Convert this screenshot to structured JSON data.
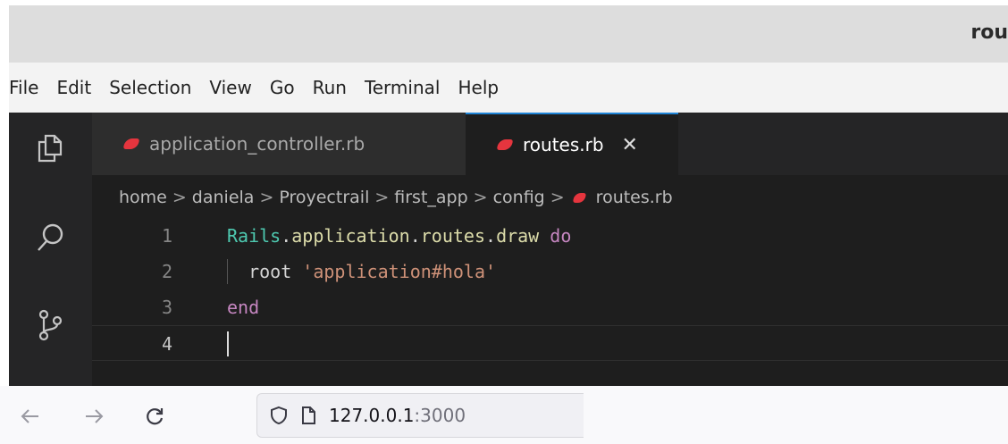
{
  "window": {
    "title": "rou"
  },
  "menu": [
    "File",
    "Edit",
    "Selection",
    "View",
    "Go",
    "Run",
    "Terminal",
    "Help"
  ],
  "activity_icons": [
    "files-icon",
    "search-icon",
    "source-control-icon"
  ],
  "tabs": [
    {
      "label": "application_controller.rb",
      "active": false
    },
    {
      "label": "routes.rb",
      "active": true,
      "close": "✕"
    }
  ],
  "breadcrumb": [
    "home",
    "daniela",
    "Proyectrail",
    "first_app",
    "config",
    "routes.rb"
  ],
  "code_lines": [
    {
      "num": "1",
      "tokens": [
        {
          "t": "Rails",
          "k": "const"
        },
        {
          "t": ".",
          "k": "plain"
        },
        {
          "t": "application",
          "k": "meth"
        },
        {
          "t": ".",
          "k": "plain"
        },
        {
          "t": "routes",
          "k": "meth"
        },
        {
          "t": ".",
          "k": "plain"
        },
        {
          "t": "draw",
          "k": "meth"
        },
        {
          "t": " ",
          "k": "plain"
        },
        {
          "t": "do",
          "k": "kw"
        }
      ]
    },
    {
      "num": "2",
      "tokens": [
        {
          "t": "  root ",
          "k": "plain"
        },
        {
          "t": "'application#hola'",
          "k": "str"
        }
      ]
    },
    {
      "num": "3",
      "tokens": [
        {
          "t": "end",
          "k": "kw"
        }
      ]
    },
    {
      "num": "4",
      "tokens": []
    }
  ],
  "browser": {
    "back_icon": "back-arrow-icon",
    "forward_icon": "forward-arrow-icon",
    "reload_icon": "reload-icon",
    "url_host": "127.0.0.1",
    "url_port": ":3000"
  },
  "colors": {
    "accent": "#1f84d6",
    "ruby": "#e5353e",
    "string": "#ce9178",
    "keyword": "#c586c0",
    "constant": "#4ec9b0",
    "method": "#dcdcaa"
  }
}
